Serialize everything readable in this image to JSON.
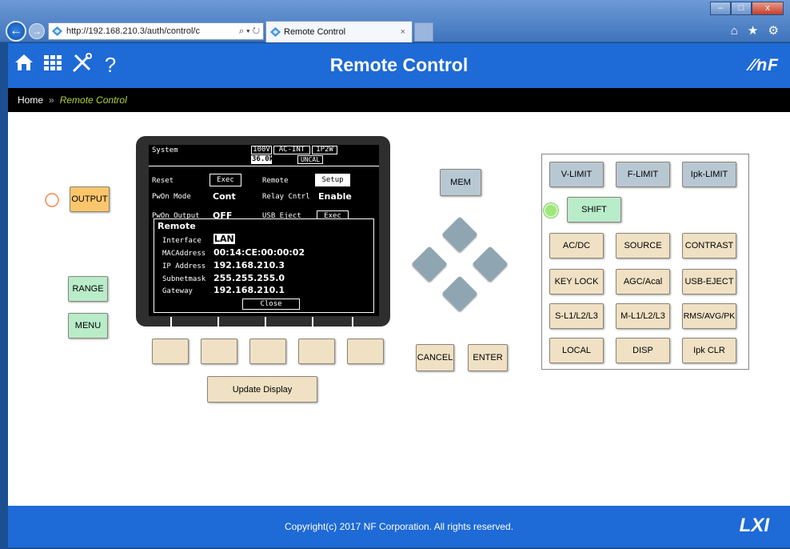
{
  "browser": {
    "address": "http://192.168.210.3/auth/control/c",
    "address_controls": "⌕ ▾ ↻",
    "tab_title": "Remote Control",
    "tab_close": "×",
    "back_glyph": "←",
    "forward_glyph": "→",
    "window_buttons": [
      "–",
      "□",
      "x"
    ],
    "right_icons": "⌂ ★ ⚙"
  },
  "header": {
    "title": "Remote Control",
    "logo": "∕∕nF",
    "icons": [
      "home-icon",
      "grid-icon",
      "tools-icon",
      "help-icon"
    ],
    "help_glyph": "?"
  },
  "breadcrumb": {
    "home": "Home",
    "separator": "»",
    "current": "Remote Control"
  },
  "left_buttons": {
    "output": "OUTPUT",
    "range": "RANGE",
    "menu": "MENU"
  },
  "lcd": {
    "top_left": "System",
    "badges": [
      "100V",
      "AC-INT",
      "1P2W"
    ],
    "freq": "36.0k",
    "uncal": "UNCAL",
    "rows": [
      {
        "label": "Reset",
        "value": "Exec",
        "label2": "Remote",
        "value2": "Setup"
      },
      {
        "label": "PwOn Mode",
        "value": "Cont",
        "label2": "Relay Cntrl",
        "value2": "Enable"
      },
      {
        "label": "PwOn Output",
        "value": "OFF",
        "label2": "USB Eject",
        "value2": "Exec"
      }
    ],
    "popup": {
      "title": "Remote",
      "fields": [
        {
          "label": "Interface",
          "value": "LAN"
        },
        {
          "label": "MACAddress",
          "value": "00:14:CE:00:00:02"
        },
        {
          "label": "IP Address",
          "value": "192.168.210.3"
        },
        {
          "label": "Subnetmask",
          "value": "255.255.255.0"
        },
        {
          "label": "Gateway",
          "value": "192.168.210.1"
        }
      ],
      "close": "Close"
    }
  },
  "update_display": "Update Display",
  "nav": {
    "mem": "MEM",
    "cancel": "CANCEL",
    "enter": "ENTER"
  },
  "panel": {
    "row1": [
      "V-LIMIT",
      "F-LIMIT",
      "Ipk-LIMIT"
    ],
    "shift": "SHIFT",
    "row2": [
      "AC/DC",
      "SOURCE",
      "CONTRAST"
    ],
    "row3": [
      "KEY LOCK",
      "AGC/Acal",
      "USB-EJECT"
    ],
    "row4": [
      "S-L1/L2/L3",
      "M-L1/L2/L3",
      "RMS/AVG/PK"
    ],
    "row5": [
      "LOCAL",
      "DISP",
      "Ipk CLR"
    ]
  },
  "footer": {
    "copyright": "Copyright(c) 2017 NF Corporation. All rights reserved.",
    "logo": "LXI"
  },
  "colors": {
    "header_blue": "#1e6ad6",
    "output_indicator": "#f4a07a",
    "shift_indicator": "#9ee87a"
  }
}
